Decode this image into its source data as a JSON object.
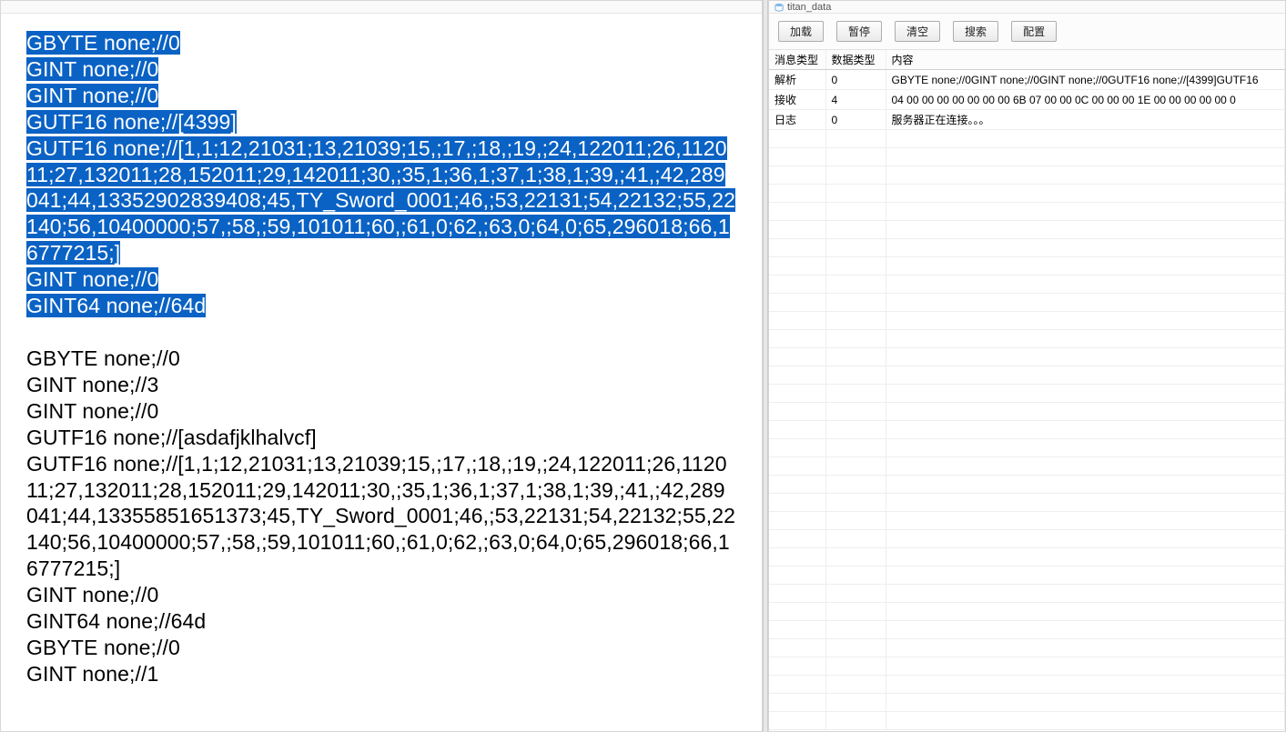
{
  "left_panel": {
    "title": "",
    "selected_lines": [
      "GBYTE none;//0",
      "GINT none;//0",
      "GINT none;//0",
      "GUTF16 none;//[4399]",
      "GUTF16 none;//[1,1;12,21031;13,21039;15,;17,;18,;19,;24,122011;26,112011;27,132011;28,152011;29,142011;30,;35,1;36,1;37,1;38,1;39,;41,;42,289041;44,13352902839408;45,TY_Sword_0001;46,;53,22131;54,22132;55,22140;56,10400000;57,;58,;59,101011;60,;61,0;62,;63,0;64,0;65,296018;66,16777215;]",
      "GINT none;//0",
      "GINT64 none;//64d"
    ],
    "gap": "",
    "plain_lines": [
      "GBYTE none;//0",
      "GINT none;//3",
      "GINT none;//0",
      "GUTF16 none;//[asdafjklhalvcf]",
      "GUTF16 none;//[1,1;12,21031;13,21039;15,;17,;18,;19,;24,122011;26,112011;27,132011;28,152011;29,142011;30,;35,1;36,1;37,1;38,1;39,;41,;42,289041;44,13355851651373;45,TY_Sword_0001;46,;53,22131;54,22132;55,22140;56,10400000;57,;58,;59,101011;60,;61,0;62,;63,0;64,0;65,296018;66,16777215;]",
      "GINT none;//0",
      "GINT64 none;//64d",
      "GBYTE none;//0",
      "GINT none;//1"
    ]
  },
  "right_panel": {
    "title": "titan_data",
    "toolbar": {
      "load": "加载",
      "pause": "暂停",
      "clear": "清空",
      "search": "搜索",
      "config": "配置"
    },
    "columns": {
      "msg_type": "消息类型",
      "data_type": "数据类型",
      "content": "内容"
    },
    "rows": [
      {
        "msg": "解析",
        "dt": "0",
        "content": "GBYTE none;//0GINT none;//0GINT none;//0GUTF16 none;//[4399]GUTF16"
      },
      {
        "msg": "接收",
        "dt": "4",
        "content": "04 00 00 00 00 00 00 00 6B 07 00 00 0C 00 00 00 1E 00 00 00 00 00 0"
      },
      {
        "msg": "日志",
        "dt": "0",
        "content": "服务器正在连接。。。"
      }
    ],
    "empty_row_count": 33
  }
}
